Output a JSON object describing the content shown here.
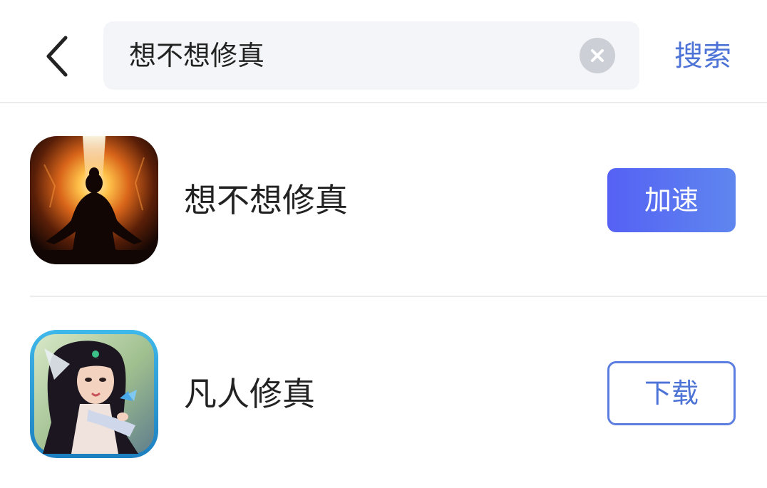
{
  "header": {
    "search": {
      "value": "想不想修真"
    },
    "search_button_label": "搜索"
  },
  "results": [
    {
      "name": "想不想修真",
      "action_label": "加速",
      "icon": "cultivation-silhouette-icon"
    },
    {
      "name": "凡人修真",
      "action_label": "下载",
      "icon": "fantasy-heroine-icon"
    }
  ],
  "colors": {
    "accent": "#4d73d6",
    "button_gradient_start": "#5561f4",
    "button_gradient_end": "#5f86ef",
    "search_bg": "#f4f5f9",
    "divider": "#ececec"
  }
}
